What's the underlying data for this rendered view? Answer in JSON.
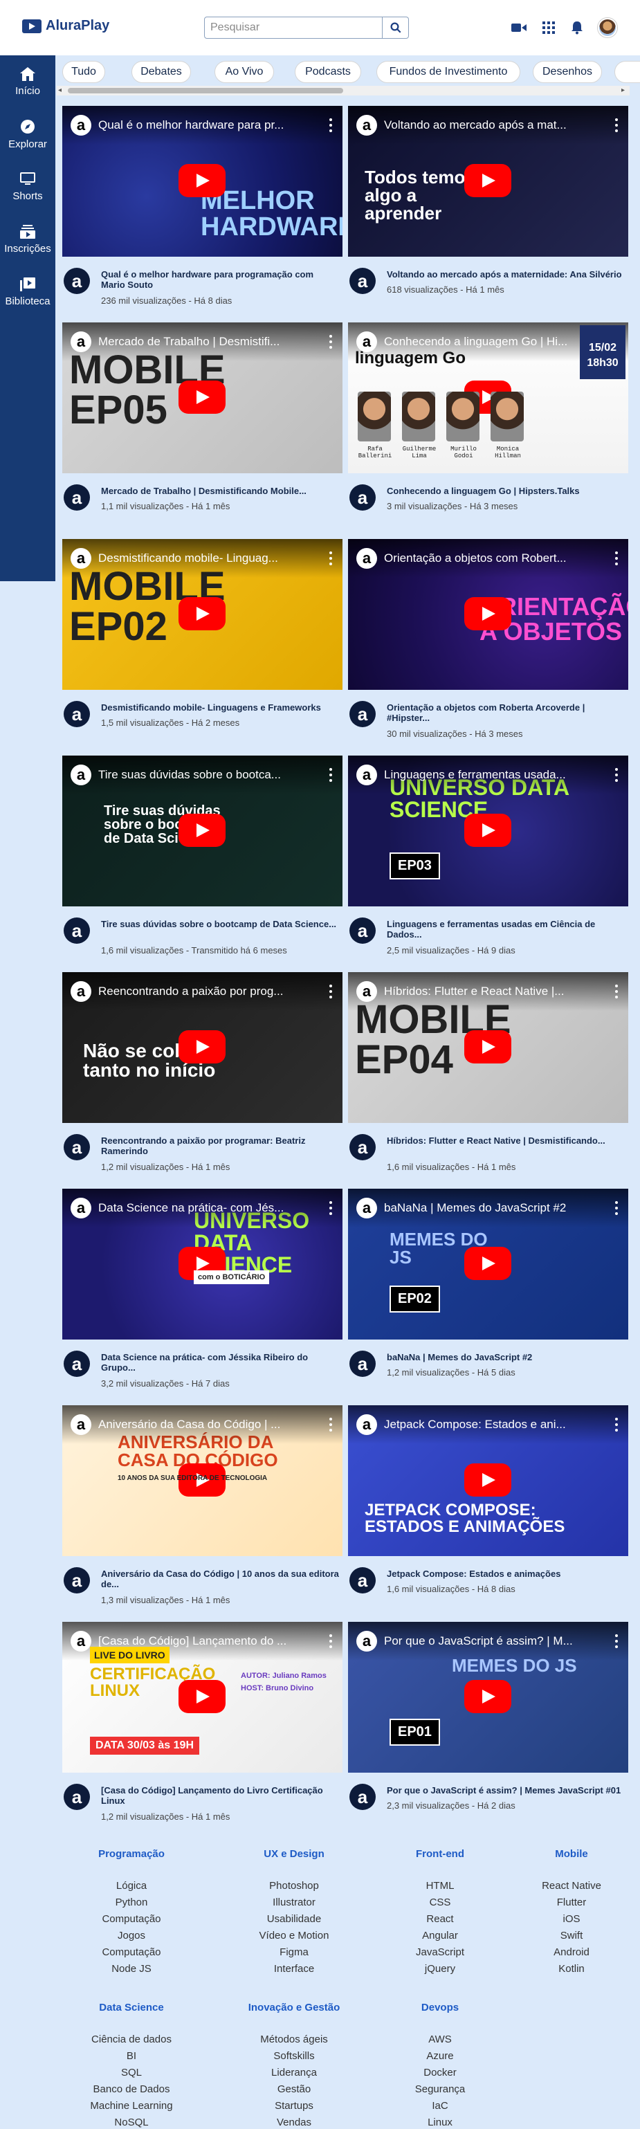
{
  "header": {
    "logo": "AluraPlay",
    "search_placeholder": "Pesquisar",
    "icons": [
      "search-icon",
      "video-camera-icon",
      "apps-grid-icon",
      "bell-icon",
      "avatar"
    ]
  },
  "sidebar": {
    "items": [
      {
        "label": "Início",
        "icon": "home-icon"
      },
      {
        "label": "Explorar",
        "icon": "compass-icon"
      },
      {
        "label": "Shorts",
        "icon": "monitor-icon"
      },
      {
        "label": "Inscrições",
        "icon": "subscriptions-icon"
      },
      {
        "label": "Biblioteca",
        "icon": "library-icon"
      }
    ]
  },
  "chips": [
    "Tudo",
    "Debates",
    "Ao Vivo",
    "Podcasts",
    "Fundos de Investimento",
    "Desenhos"
  ],
  "videos": [
    {
      "title": "Qual é o melhor hardware para programação com Mario Souto",
      "thumb_title": "Qual é o melhor hardware para pr...",
      "stats": "236 mil visualizações - Há 8 dias",
      "overlay": "O MELHOR HARDWARE"
    },
    {
      "title": "Voltando ao mercado após a maternidade: Ana Silvério",
      "thumb_title": "Voltando ao mercado após a mat...",
      "stats": "618 visualizações - Há 1 mês",
      "overlay": "Todos temos algo a aprender"
    },
    {
      "title": "Mercado de Trabalho | Desmistificando Mobile...",
      "thumb_title": "Mercado de Trabalho | Desmistifi...",
      "stats": "1,1 mil visualizações - Há 1 mês",
      "overlay": "MOBILE EP05"
    },
    {
      "title": "Conhecendo a linguagem Go | Hipsters.Talks",
      "thumb_title": "Conhecendo a linguagem Go | Hi...",
      "stats": "3 mil visualizações - Há 3 meses",
      "overlay": "linguagem Go",
      "badge_date": "15/02",
      "badge_time": "18h30",
      "speakers": [
        "Rafa Ballerini",
        "Guilherme Lima",
        "Murillo Godoi",
        "Monica Hillman"
      ]
    },
    {
      "title": "Desmistificando mobile- Linguagens e Frameworks",
      "thumb_title": "Desmistificando mobile- Linguag...",
      "stats": "1,5 mil visualizações - Há 2 meses",
      "overlay": "MOBILE EP02"
    },
    {
      "title": "Orientação a objetos com Roberta Arcoverde | #Hipster...",
      "thumb_title": "Orientação a objetos com Robert...",
      "stats": "30 mil visualizações - Há 3 meses",
      "overlay": "ORIENTAÇÃO A OBJETOS"
    },
    {
      "title": "Tire suas dúvidas sobre o bootcamp de Data Science...",
      "thumb_title": "Tire suas dúvidas sobre o bootca...",
      "stats": "1,6 mil visualizações - Transmitido há 6 meses",
      "overlay": "Tire suas dúvidas sobre o bootcamp de Data Science"
    },
    {
      "title": "Linguagens e ferramentas usadas em Ciência de Dados...",
      "thumb_title": "Linguagens e ferramentas usada...",
      "stats": "2,5 mil visualizações - Há 9 dias",
      "overlay": "UNIVERSO DATA SCIENCE",
      "ep": "EP03"
    },
    {
      "title": "Reencontrando a paixão por programar: Beatriz Ramerindo",
      "thumb_title": "Reencontrando a paixão por prog...",
      "stats": "1,2 mil visualizações - Há 1 mês",
      "overlay": "Não se cobre tanto no início"
    },
    {
      "title": "Híbridos: Flutter e React Native | Desmistificando...",
      "thumb_title": "Híbridos: Flutter e React Native |...",
      "stats": "1,6 mil visualizações - Há 1 mês",
      "overlay": "MOBILE EP04"
    },
    {
      "title": "Data Science na prática- com Jéssika Ribeiro do Grupo...",
      "thumb_title": "Data Science na prática- com Jés...",
      "stats": "3,2 mil visualizações - Há 7 dias",
      "overlay": "UNIVERSO DATA SCIENCE",
      "sub": "com o BOTICÁRIO"
    },
    {
      "title": "baNaNa | Memes do JavaScript #2",
      "thumb_title": "baNaNa | Memes do JavaScript #2",
      "stats": "1,2 mil visualizações - Há 5 dias",
      "overlay": "MEMES DO JS",
      "ep": "EP02"
    },
    {
      "title": "Aniversário da Casa do Código | 10 anos da sua editora de...",
      "thumb_title": "Aniversário da Casa do Código | ...",
      "stats": "1,3 mil visualizações - Há 1 mês",
      "overlay": "ANIVERSÁRIO DA CASA DO CÓDIGO",
      "sub": "10 ANOS DA SUA EDITORA DE TECNOLOGIA"
    },
    {
      "title": "Jetpack Compose: Estados e animações",
      "thumb_title": "Jetpack Compose: Estados e ani...",
      "stats": "1,6 mil visualizações - Há 8 dias",
      "overlay": "JETPACK COMPOSE: ESTADOS E ANIMAÇÕES"
    },
    {
      "title": "[Casa do Código] Lançamento do Livro Certificação Linux",
      "thumb_title": "[Casa do Código] Lançamento do ...",
      "stats": "1,2 mil visualizações - Há 1 mês",
      "overlay": "CERTIFICAÇÃO LINUX",
      "sub": "LIVE DO LIVRO",
      "date": "DATA 30/03 às 19H",
      "author": "AUTOR: Juliano Ramos",
      "host": "HOST: Bruno Divino"
    },
    {
      "title": "Por que o JavaScript é assim? | Memes JavaScript #01",
      "thumb_title": "Por que o JavaScript é assim? | M...",
      "stats": "2,3 mil visualizações - Há 2 dias",
      "overlay": "MEMES DO JS",
      "ep": "EP01"
    }
  ],
  "footer": {
    "columns": [
      {
        "heading": "Programação",
        "links": [
          "Lógica",
          "Python",
          "Computação",
          "Jogos",
          "Computação",
          "Node JS"
        ]
      },
      {
        "heading": "UX e Design",
        "links": [
          "Photoshop",
          "Illustrator",
          "Usabilidade",
          "Vídeo e Motion",
          "Figma",
          "Interface"
        ]
      },
      {
        "heading": "Front-end",
        "links": [
          "HTML",
          "CSS",
          "React",
          "Angular",
          "JavaScript",
          "jQuery"
        ]
      },
      {
        "heading": "Mobile",
        "links": [
          "React Native",
          "Flutter",
          "iOS",
          "Swift",
          "Android",
          "Kotlin"
        ]
      },
      {
        "heading": "Data Science",
        "links": [
          "Ciência de dados",
          "BI",
          "SQL",
          "Banco de Dados",
          "Machine Learning",
          "NoSQL"
        ]
      },
      {
        "heading": "Inovação e Gestão",
        "links": [
          "Métodos ágeis",
          "Softskills",
          "Liderança",
          "Gestão",
          "Startups",
          "Vendas"
        ]
      },
      {
        "heading": "Devops",
        "links": [
          "AWS",
          "Azure",
          "Docker",
          "Segurança",
          "IaC",
          "Linux"
        ]
      }
    ]
  },
  "colors": {
    "brand": "#1d3f82",
    "sidebar": "#173a73",
    "page_bg": "#dbe9fa",
    "play": "#ff0000",
    "footer_heading": "#1e5bc6"
  }
}
